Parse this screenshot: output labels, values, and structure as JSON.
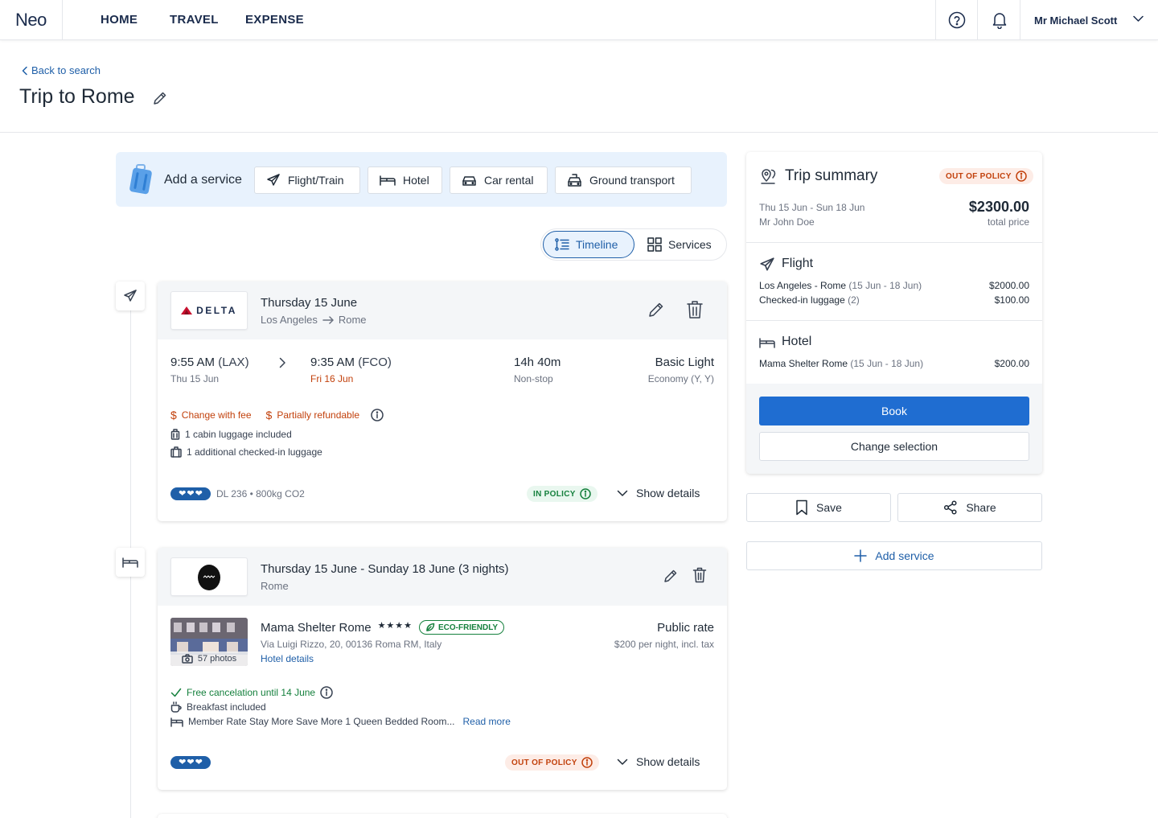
{
  "nav": {
    "logo": "Neo",
    "items": [
      "HOME",
      "TRAVEL",
      "EXPENSE"
    ],
    "user": "Mr Michael Scott",
    "help_icon": "help-icon",
    "bell_icon": "bell-icon"
  },
  "header": {
    "back_label": "Back to search",
    "title": "Trip to Rome"
  },
  "add_service": {
    "label": "Add a service",
    "buttons": [
      "Flight/Train",
      "Hotel",
      "Car rental",
      "Ground transport"
    ]
  },
  "view_toggle": {
    "timeline": "Timeline",
    "services": "Services",
    "active": "Timeline"
  },
  "flight_card": {
    "airline": "DELTA",
    "date": "Thursday 15 June",
    "from_city": "Los Angeles",
    "to_city": "Rome",
    "depart_time": "9:55 AM",
    "depart_code": "(LAX)",
    "depart_date": "Thu 15 Jun",
    "arrive_time": "9:35 AM",
    "arrive_code": "(FCO)",
    "arrive_date": "Fri 16 Jun",
    "duration": "14h 40m",
    "stops": "Non-stop",
    "fare": "Basic Light",
    "cabin": "Economy (Y, Y)",
    "change_fee": "Change with fee",
    "refund": "Partially refundable",
    "cabin_luggage": "1 cabin luggage included",
    "checked_luggage": "1 additional checked-in luggage",
    "flight_info": "DL 236 • 800kg CO2",
    "policy": "IN POLICY",
    "show_details": "Show details"
  },
  "hotel_card": {
    "date": "Thursday 15 June - Sunday 18 June (3 nights)",
    "city": "Rome",
    "name": "Mama Shelter Rome",
    "stars": "★★★★",
    "eco": "ECO-FRIENDLY",
    "address": "Via Luigi Rizzo, 20, 00136 Roma RM, Italy",
    "details_link": "Hotel details",
    "photos": "57 photos",
    "rate_name": "Public rate",
    "rate_price": "$200 per night, incl. tax",
    "cancel": "Free cancelation until 14 June",
    "breakfast": "Breakfast included",
    "room": "Member Rate Stay More Save More 1 Queen Bedded Room...",
    "read_more": "Read more",
    "policy": "OUT OF POLICY",
    "show_details": "Show details"
  },
  "summary": {
    "title": "Trip summary",
    "policy": "OUT OF POLICY",
    "dates": "Thu 15 Jun - Sun 18 Jun",
    "traveler": "Mr John Doe",
    "total": "$2300.00",
    "total_label": "total price",
    "flight_title": "Flight",
    "flight_route": "Los Angeles - Rome",
    "flight_range": "(15 Jun - 18 Jun)",
    "flight_price": "$2000.00",
    "luggage_label": "Checked-in luggage",
    "luggage_count": "(2)",
    "luggage_price": "$100.00",
    "hotel_title": "Hotel",
    "hotel_name": "Mama Shelter Rome",
    "hotel_range": "(15 Jun - 18 Jun)",
    "hotel_price": "$200.00",
    "book": "Book",
    "change": "Change selection"
  },
  "side_actions": {
    "save": "Save",
    "share": "Share",
    "add_service": "Add service"
  },
  "colors": {
    "primary": "#1f6dd1",
    "link": "#1f5fa8",
    "warning": "#c2410c",
    "success": "#15803d",
    "service_bar": "#e8f2fd",
    "delta_red": "#c8102e"
  }
}
